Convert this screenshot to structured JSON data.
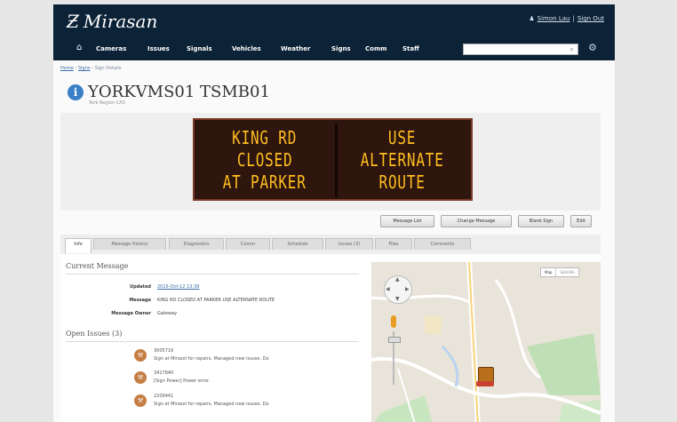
{
  "app": {
    "logo_mark": "Ƶ",
    "name": "Mirasan"
  },
  "user": {
    "name": "Simon Lau",
    "separator": "|",
    "sign_out": "Sign Out"
  },
  "nav": {
    "home_icon": "home-icon",
    "items": [
      "Cameras",
      "Issues",
      "Signals",
      "Vehicles",
      "Weather",
      "Signs",
      "Comm",
      "Staff"
    ],
    "search_placeholder": ""
  },
  "breadcrumb": [
    "Home",
    "Signs",
    "Sign Details"
  ],
  "device": {
    "title": "YORKVMS01 TSMB01",
    "subtitle": "York Region CAS"
  },
  "sign_message": {
    "left": [
      "KING RD",
      "CLOSED",
      "AT PARKER"
    ],
    "right": [
      "USE",
      "ALTERNATE",
      "ROUTE"
    ],
    "led_color": "#ffbe20",
    "background_color": "#2e150d"
  },
  "actions": [
    "Message List",
    "Change Message",
    "Blank Sign",
    "Edit"
  ],
  "tabs": [
    "Info",
    "Message History",
    "Diagnostics",
    "Comm",
    "Schedule",
    "Issues (3)",
    "Files",
    "Comments"
  ],
  "active_tab": "Info",
  "current_message": {
    "heading": "Current Message",
    "updated_label": "Updated",
    "updated_value": "2015-Oct-12 13:39",
    "message_label": "Message",
    "message_value": "KING RD CLOSED AT PARKER USE ALTERNATE ROUTE",
    "owner_label": "Message Owner",
    "owner_value": "Gateway"
  },
  "open_issues": {
    "heading": "Open Issues (3)",
    "items": [
      {
        "id": "3005716",
        "desc": "Sign at Mirasol for repairs, Managed new issues. Do"
      },
      {
        "id": "3417840",
        "desc": "[Sign Power] Power error."
      },
      {
        "id": "2209441",
        "desc": "Sign at Mirasol for repairs, Managed new issues. Do"
      }
    ]
  },
  "map": {
    "type_options": [
      "Map",
      "Satellite"
    ],
    "selected_type": "Map"
  },
  "colors": {
    "header_bg": "#0c2236",
    "link": "#3b6ca8",
    "accent_info": "#3a7fc7"
  }
}
